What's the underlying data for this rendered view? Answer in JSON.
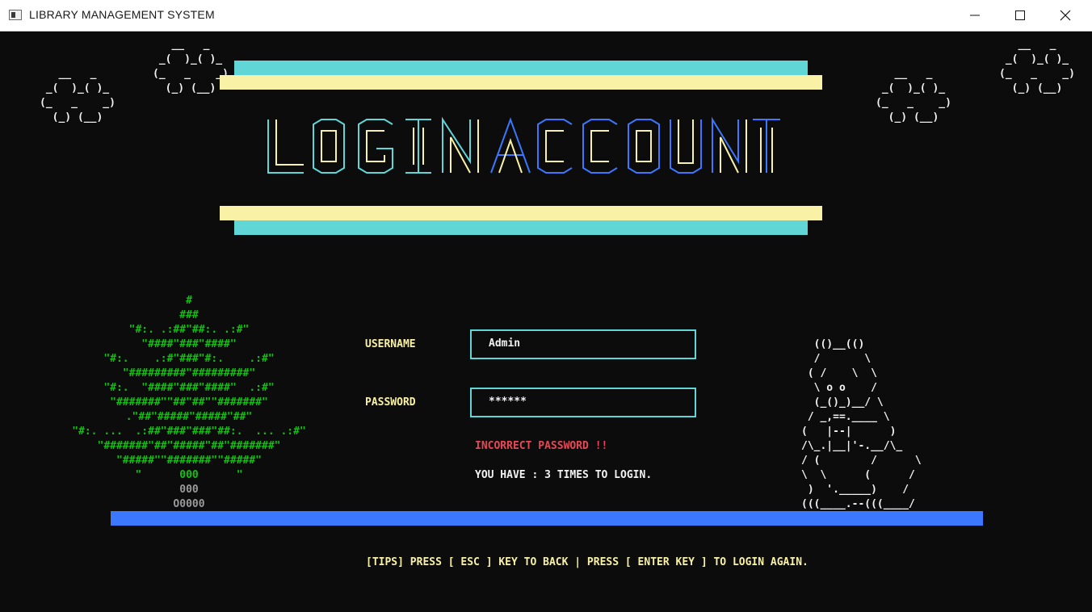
{
  "window": {
    "title": "LIBRARY MANAGEMENT SYSTEM",
    "minimize_icon": "minimize-icon",
    "maximize_icon": "maximize-icon",
    "close_icon": "close-icon"
  },
  "art": {
    "cloud": "   __   _\n _(  )_( )_\n(_   _    _)\n  (_) (__)",
    "logo_line1": " _       ___   ____  ___  _   _      _     ____  ____  ___   _   _  _   _  _____",
    "tree_top": "#\n###\n\"#:. .:##\"##:. .:#\"\n\"####\"###\"####\"\n\"#:.    .:#\"###\"#:.    .:#\"\n\"#########\"#########\"\n\"#:.  \"####\"###\"####\"  .:#\"\n\"#######\"\"##\"##\"\"#######\"\n.\"##\"#####\"#####\"##\"\n\"#:. ...  .:##\"###\"###\"##:.  ... .:#\"\n\"#######\"##\"#####\"##\"#######\"\n\"#####\"\"#######\"\"#####\"\n\"      000      \"",
    "tree_trunk": "000\nO0000",
    "creature": "  (()__(()\n  /       \\\n ( /    \\  \\\n  \\ o o    /\n  (_()_)__/ \\\n / _,==.____ \\\n(   |--|      )\n/\\_.|__|'-.__/\\_\n/ (        /      \\\n\\  \\      (      /\n )  '._____)    /\n(((____.--(((____/"
  },
  "form": {
    "username_label": "USERNAME",
    "username_value": "Admin",
    "password_label": "PASSWORD",
    "password_value": "******",
    "error_message": "INCORRECT PASSWORD !!",
    "attempts_message": "YOU HAVE : 3 TIMES TO LOGIN."
  },
  "footer": {
    "tips": "[TIPS] PRESS [ ESC ] KEY TO BACK | PRESS [ ENTER KEY ] TO LOGIN AGAIN."
  },
  "colors": {
    "background": "#0c0c0c",
    "cyan": "#61d6d6",
    "cream": "#f9f1a5",
    "blue": "#3b78ff",
    "green": "#13c013",
    "red": "#e74856"
  }
}
